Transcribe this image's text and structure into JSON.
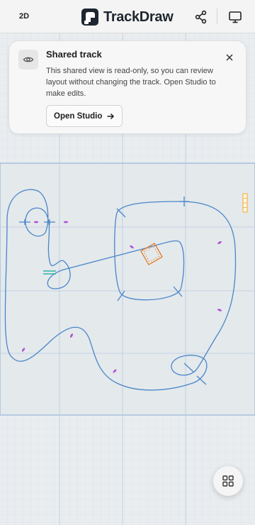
{
  "topbar": {
    "mode_label": "2D",
    "brand_name": "TrackDraw",
    "icons": {
      "logo": "trackdraw-logo-icon",
      "share": "share-icon",
      "monitor": "monitor-icon"
    }
  },
  "banner": {
    "title": "Shared track",
    "body": "This shared view is read-only, so you can review layout without changing the track. Open Studio to make edits.",
    "button_label": "Open Studio",
    "icons": {
      "eye": "eye-icon",
      "close": "close-icon",
      "arrow": "arrow-right-icon"
    }
  },
  "fab": {
    "icon": "grid-icon"
  },
  "colors": {
    "accent": "#4a86c8",
    "gate_orange": "#e57a22",
    "marker_purple": "#b14fd6",
    "start_teal": "#2fb3a3",
    "side_ruler": "#f0a320"
  }
}
